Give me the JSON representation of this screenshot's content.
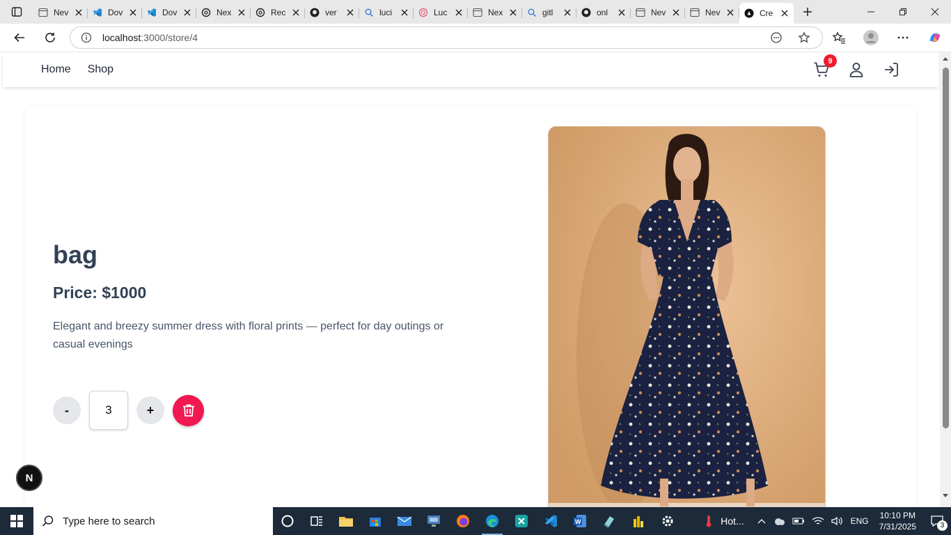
{
  "browser": {
    "tabs": [
      {
        "title": "Nev",
        "icon": "page-icon"
      },
      {
        "title": "Dov",
        "icon": "vscode-icon"
      },
      {
        "title": "Dov",
        "icon": "vscode-icon"
      },
      {
        "title": "Nex",
        "icon": "openai-icon"
      },
      {
        "title": "Rec",
        "icon": "openai-icon"
      },
      {
        "title": "ver",
        "icon": "github-icon"
      },
      {
        "title": "luci",
        "icon": "search-icon"
      },
      {
        "title": "Luc",
        "icon": "lucide-icon"
      },
      {
        "title": "Nex",
        "icon": "page-icon"
      },
      {
        "title": "gitl",
        "icon": "search-icon"
      },
      {
        "title": "onl",
        "icon": "github-icon"
      },
      {
        "title": "Nev",
        "icon": "page-icon"
      },
      {
        "title": "Nev",
        "icon": "page-icon"
      },
      {
        "title": "Cre",
        "icon": "nextjs-icon",
        "active": true
      }
    ],
    "url_host": "localhost",
    "url_path": ":3000/store/4"
  },
  "site": {
    "nav": {
      "home": "Home",
      "shop": "Shop"
    },
    "cart_count": "9"
  },
  "product": {
    "title": "bag",
    "price": "Price: $1000",
    "description": "Elegant and breezy summer dress with floral prints — perfect for day outings or casual evenings",
    "quantity": "3",
    "decrement_label": "-",
    "increment_label": "+"
  },
  "next_badge": "N",
  "taskbar": {
    "search_placeholder": "Type here to search",
    "weather": "Hot...",
    "language": "ENG",
    "time": "10:10 PM",
    "date": "7/31/2025",
    "notifications": "3"
  },
  "colors": {
    "accent_delete": "#f01952",
    "badge_red": "#ef1b2f",
    "text_dark": "#334155",
    "taskbar": "#1c2a3a"
  }
}
